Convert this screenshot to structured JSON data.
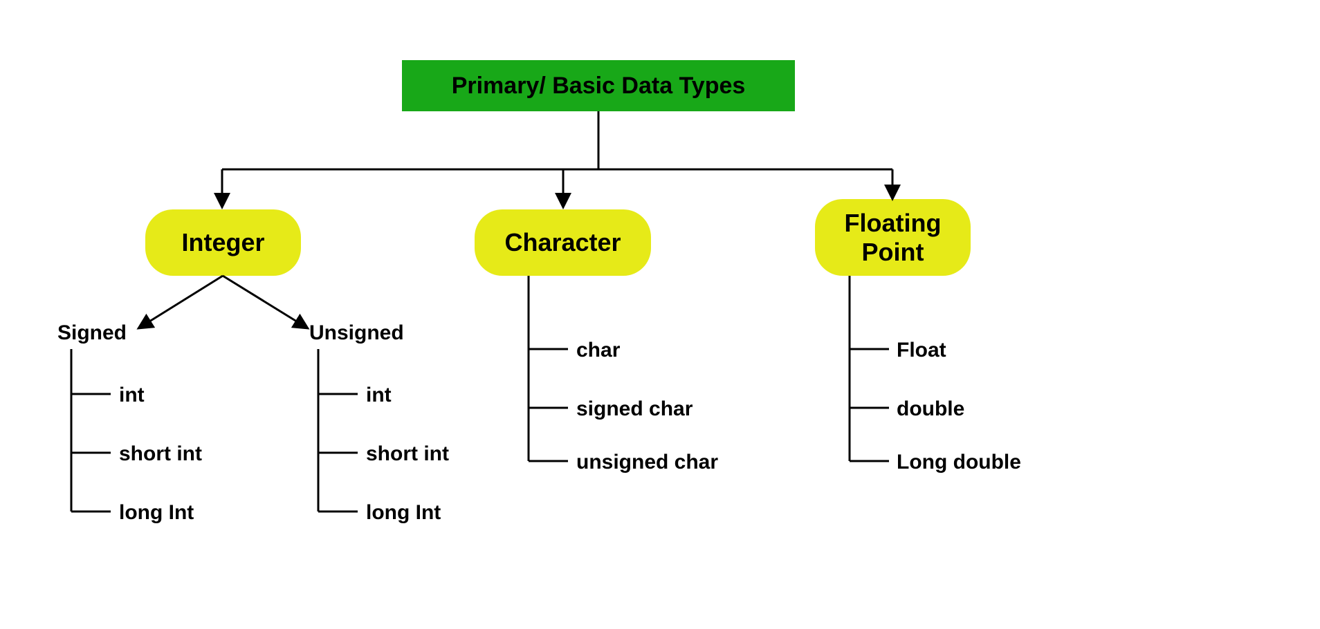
{
  "root": {
    "title": "Primary/ Basic Data Types"
  },
  "branches": {
    "integer": {
      "label": "Integer"
    },
    "character": {
      "label": "Character"
    },
    "floating": {
      "label": "Floating Point"
    }
  },
  "integer_sub": {
    "signed": {
      "label": "Signed",
      "items": [
        "int",
        "short int",
        "long Int"
      ]
    },
    "unsigned": {
      "label": "Unsigned",
      "items": [
        "int",
        "short int",
        "long Int"
      ]
    }
  },
  "character_items": [
    "char",
    "signed char",
    "unsigned char"
  ],
  "floating_items": [
    "Float",
    "double",
    "Long double"
  ]
}
